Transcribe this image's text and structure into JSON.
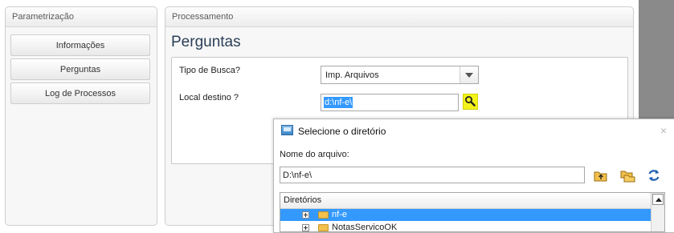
{
  "left_panel": {
    "title": "Parametrização",
    "items": [
      {
        "label": "Informações"
      },
      {
        "label": "Perguntas"
      },
      {
        "label": "Log de Processos"
      }
    ]
  },
  "right_panel": {
    "title": "Processamento",
    "page_title": "Perguntas",
    "fields": {
      "tipo_busca_label": "Tipo de Busca?",
      "tipo_busca_value": "Imp. Arquivos",
      "local_destino_label": "Local destino ?",
      "local_destino_value": "d:\\nf-e\\"
    }
  },
  "dialog": {
    "title": "Selecione o diretório",
    "close": "×",
    "file_name_label": "Nome do arquivo:",
    "path_value": "D:\\nf-e\\",
    "tree_header": "Diretórios",
    "tree_items": [
      {
        "label": "nf-e",
        "selected": true
      },
      {
        "label": "NotasServicoOK",
        "selected": false
      }
    ]
  },
  "colors": {
    "accent_selection": "#3399ff",
    "search_button": "#f3f31a",
    "title_text": "#2b3e57"
  },
  "icons": [
    "search-icon",
    "folder-up-icon",
    "new-folder-icon",
    "refresh-icon",
    "folder-icon",
    "expand-icon",
    "window-icon",
    "close-icon",
    "dropdown-arrow-icon"
  ]
}
